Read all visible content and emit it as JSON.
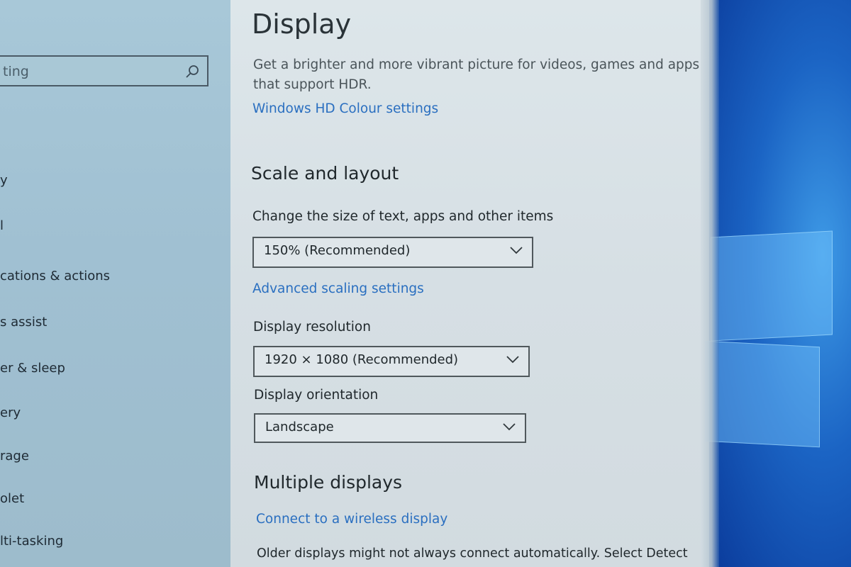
{
  "sidebar": {
    "search_text": "ting",
    "items": [
      {
        "label": "y"
      },
      {
        "label": "l"
      },
      {
        "label": "cations & actions"
      },
      {
        "label": "s assist"
      },
      {
        "label": "er & sleep"
      },
      {
        "label": "ery"
      },
      {
        "label": "rage"
      },
      {
        "label": "olet"
      },
      {
        "label": "lti-tasking"
      }
    ]
  },
  "main": {
    "title": "Display",
    "hdr": {
      "description_line1": "Get a brighter and more vibrant picture for videos, games and apps",
      "description_line2": "that support HDR.",
      "link": "Windows HD Colour settings"
    },
    "scale_layout": {
      "heading": "Scale and layout",
      "scale_label": "Change the size of text, apps and other items",
      "scale_value": "150% (Recommended)",
      "advanced_link": "Advanced scaling settings",
      "resolution_label": "Display resolution",
      "resolution_value": "1920 × 1080 (Recommended)",
      "orientation_label": "Display orientation",
      "orientation_value": "Landscape"
    },
    "multiple_displays": {
      "heading": "Multiple displays",
      "wireless_link": "Connect to a wireless display",
      "note": "Older displays might not always connect automatically. Select Detect"
    }
  },
  "icons": {
    "search": "search-icon",
    "dropdown": "chevron-down-icon"
  },
  "colors": {
    "link": "#2a6fc0",
    "panel_bg": "#dde6ea",
    "sidebar_bg": "#a8c8d8",
    "desktop_blue": "#1b64c4"
  }
}
